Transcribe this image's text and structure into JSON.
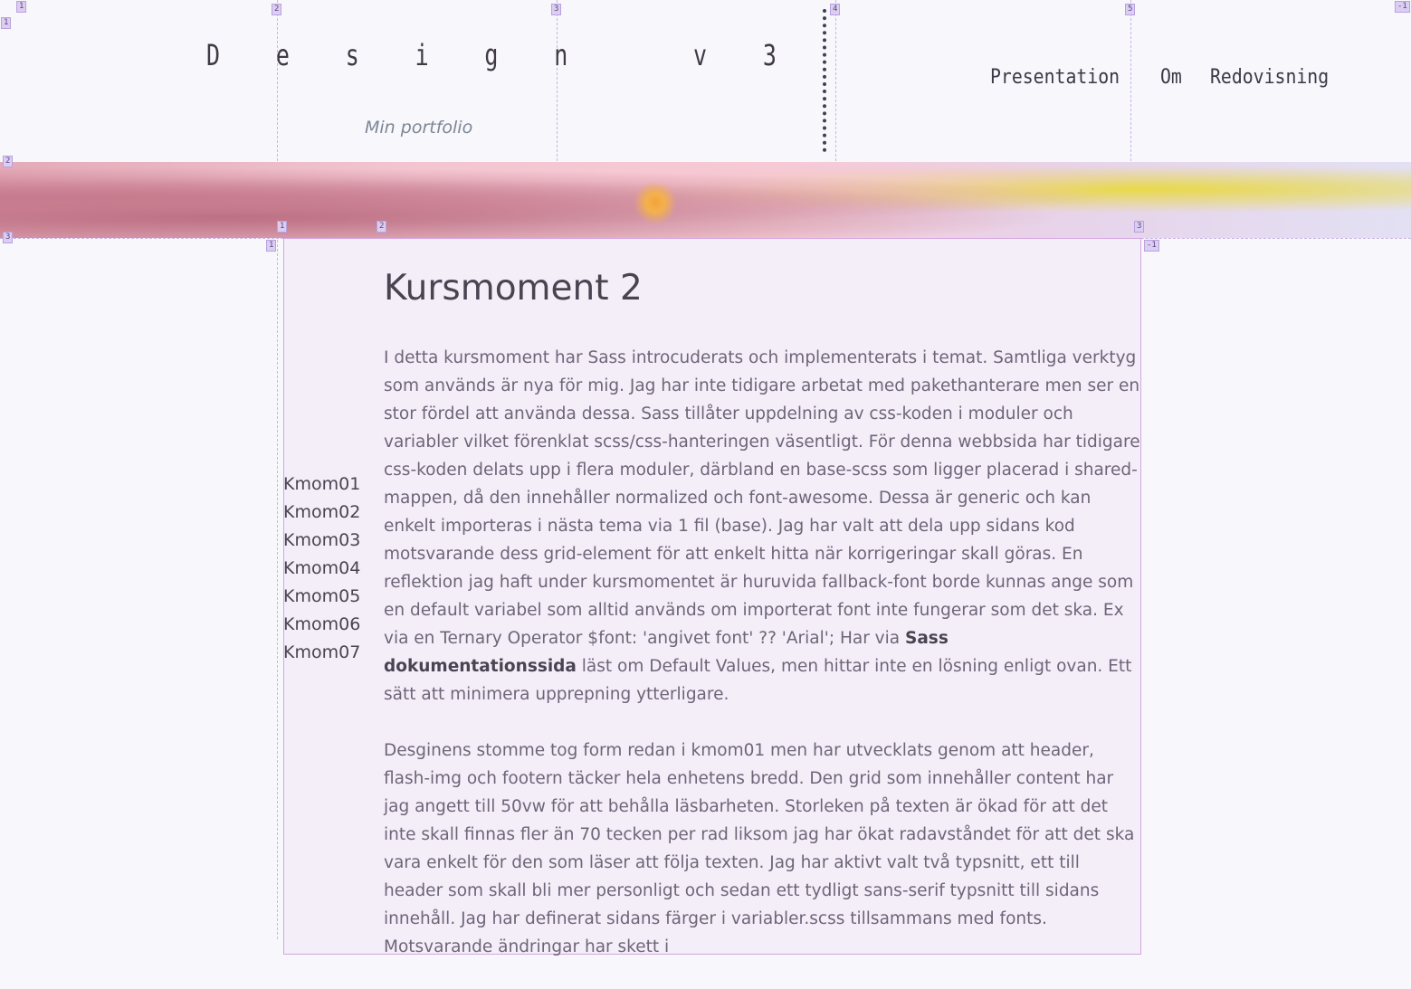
{
  "header": {
    "logo": "D e s i g n   v 3",
    "subtitle": "Min portfolio",
    "nav": [
      {
        "label": "Presentation"
      },
      {
        "label": "Om"
      },
      {
        "label": "Redovisning"
      }
    ]
  },
  "sidebar": {
    "items": [
      {
        "label": "Kmom01"
      },
      {
        "label": "Kmom02"
      },
      {
        "label": "Kmom03"
      },
      {
        "label": "Kmom04"
      },
      {
        "label": "Kmom05"
      },
      {
        "label": "Kmom06"
      },
      {
        "label": "Kmom07"
      }
    ]
  },
  "main": {
    "heading": "Kursmoment 2",
    "p1_intro": "I detta kursmoment har Sass introcuderats och implementerats i temat. Samtliga verktyg som används är nya för mig. Jag har inte tidigare arbetat med pakethanterare men ser en stor fördel att använda dessa. Sass tillåter uppdelning av css-koden i moduler och variabler vilket förenklat scss/css-hanteringen väsentligt. För denna webbsida har tidigare css-koden delats upp i flera moduler, därbland en base-scss som ligger placerad i shared-mappen, då den innehåller normalized och font-awesome. Dessa är generic och kan enkelt importeras i nästa tema via 1 fil (base). Jag har valt att dela upp sidans kod motsvarande dess grid-element för att enkelt hitta när korrigeringar skall göras. En reflektion jag haft under kursmomentet är huruvida fallback-font borde kunnas ange som en default variabel som alltid används om importerat font inte fungerar som det ska. Ex via en Ternary Operator $font: 'angivet font' ?? 'Arial'; Har via",
    "p1_link": "Sass dokumentationssida",
    "p1_outro": "läst om Default Values, men hittar inte en lösning enligt ovan. Ett sätt att minimera upprepning ytterligare.",
    "p2": "Desginens stomme tog form redan i kmom01 men har utvecklats genom att header, flash-img och footern täcker hela enhetens bredd. Den grid som innehåller content har jag angett till 50vw för att behålla läsbarheten. Storleken på texten är ökad för att det inte skall finnas fler än 70 tecken per rad liksom jag har ökat radavståndet för att det ska vara enkelt för den som läser att följa texten. Jag har aktivt valt två typsnitt, ett till header som skall bli mer personligt och sedan ett tydligt sans-serif typsnitt till sidans innehåll. Jag har definerat sidans färger i variabler.scss tillsammans med fonts. Motsvarande ändringar har skett i"
  },
  "grid_badges": {
    "cols_top": [
      "1",
      "2",
      "3",
      "4",
      "5",
      "-1"
    ],
    "rows_left": [
      "1",
      "2",
      "3"
    ],
    "inner": [
      "1",
      "2",
      "3",
      "1",
      "-1"
    ]
  },
  "colors": {
    "background": "#f8f7fc",
    "content_bg": "#f4eef9",
    "grid_overlay": "#c9b5e4",
    "text": "#6e6578"
  }
}
